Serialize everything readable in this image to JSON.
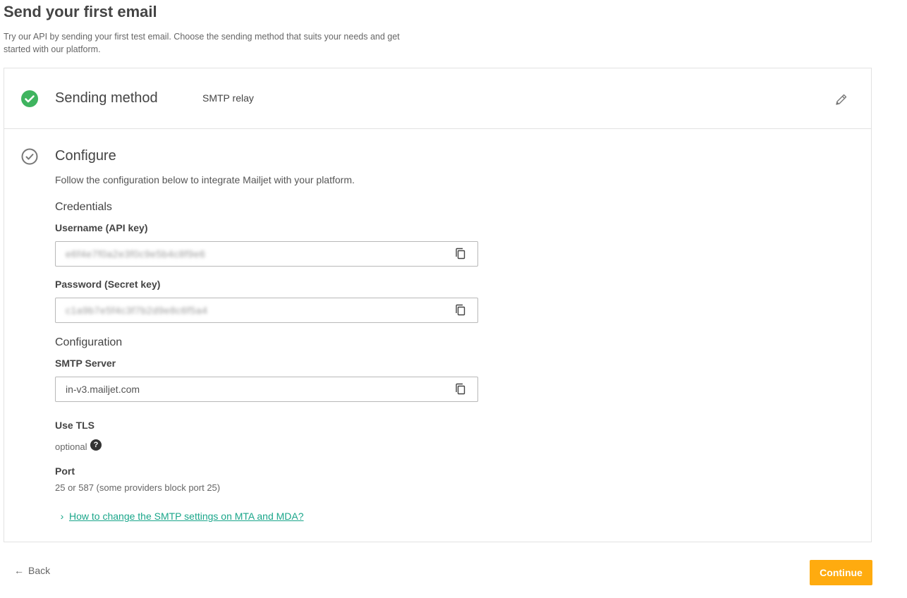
{
  "header": {
    "title": "Send your first email",
    "subtitle": "Try our API by sending your first test email. Choose the sending method that suits your needs and get started with our platform."
  },
  "step1": {
    "title": "Sending method",
    "value": "SMTP relay",
    "status_icon": "check-circle-filled-icon",
    "edit_icon": "pencil-icon"
  },
  "step2": {
    "title": "Configure",
    "description": "Follow the configuration below to integrate Mailjet with your platform.",
    "status_icon": "check-circle-outline-icon",
    "credentials_heading": "Credentials",
    "username_label": "Username (API key)",
    "username_value": "e6f4e7f0a2e3f0c9e5b4c8f9e6",
    "password_label": "Password (Secret key)",
    "password_value": "c1a9b7e5f4c3f7b2d9e8c6f5a4",
    "configuration_heading": "Configuration",
    "smtp_label": "SMTP Server",
    "smtp_value": "in-v3.mailjet.com",
    "tls_label": "Use TLS",
    "tls_value": "optional",
    "port_label": "Port",
    "port_value": "25 or 587 (some providers block port 25)",
    "help_link": "How to change the SMTP settings on MTA and MDA?"
  },
  "footer": {
    "back_label": "Back",
    "continue_label": "Continue"
  },
  "colors": {
    "accent": "#ffab0f",
    "success": "#3fb45f",
    "link": "#1aa68a"
  }
}
